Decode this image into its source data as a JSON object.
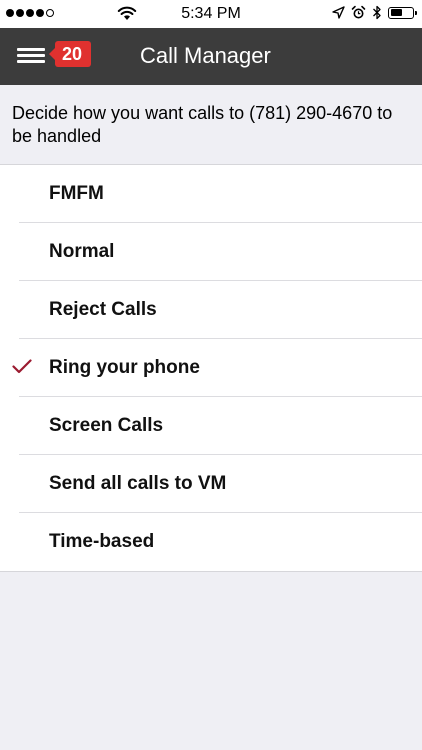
{
  "status_bar": {
    "time": "5:34 PM",
    "signal_bars_filled": 4,
    "signal_bars_total": 5,
    "battery_level": 0.55,
    "icons": [
      "signal-dots-icon",
      "wifi-icon",
      "location-arrow-icon",
      "alarm-clock-icon",
      "bluetooth-icon",
      "battery-icon"
    ]
  },
  "nav": {
    "title": "Call Manager",
    "badge_count": "20",
    "menu_icon": "hamburger-menu-icon",
    "background_color": "#3c3c3c",
    "badge_color": "#e0312f"
  },
  "description": "Decide how you want calls to (781) 290-4670 to be handled",
  "options": [
    {
      "label": "FMFM",
      "selected": false
    },
    {
      "label": "Normal",
      "selected": false
    },
    {
      "label": "Reject Calls",
      "selected": false
    },
    {
      "label": "Ring your phone",
      "selected": true
    },
    {
      "label": "Screen Calls",
      "selected": false
    },
    {
      "label": "Send all calls to VM",
      "selected": false
    },
    {
      "label": "Time-based",
      "selected": false
    }
  ],
  "colors": {
    "checkmark": "#9b1b30",
    "page_background": "#efeff4"
  }
}
